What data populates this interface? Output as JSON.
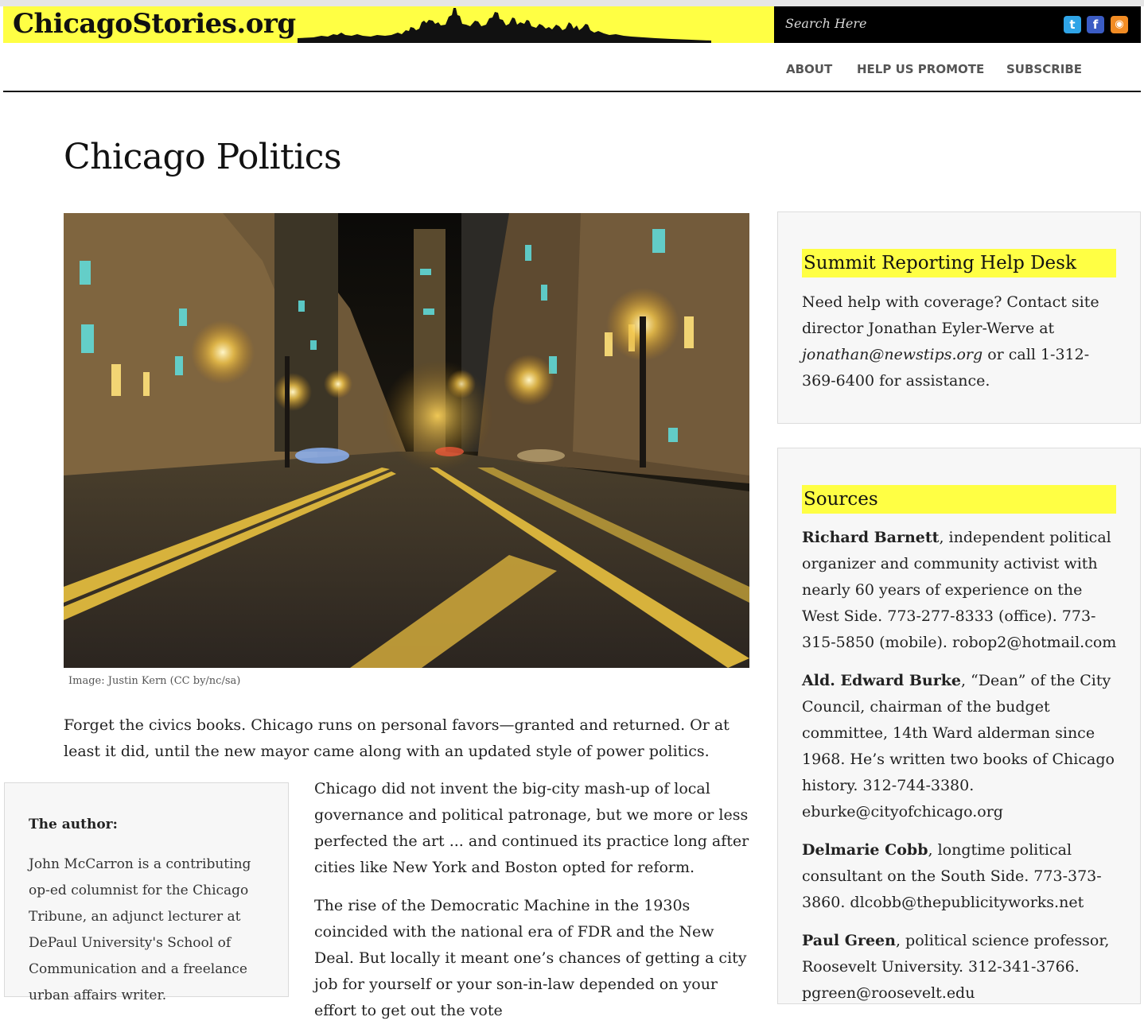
{
  "header": {
    "logo_text": "ChicagoStories.org",
    "search_placeholder": "Search Here",
    "social": [
      {
        "icon": "twitter-icon",
        "glyph": "t",
        "color": "#2fa4e7"
      },
      {
        "icon": "facebook-icon",
        "glyph": "f",
        "color": "#3b5cc4"
      },
      {
        "icon": "rss-icon",
        "glyph": "◉",
        "color": "#f28c24"
      }
    ],
    "nav": [
      "ABOUT",
      "HELP US PROMOTE",
      "SUBSCRIBE"
    ]
  },
  "article": {
    "title": "Chicago Politics",
    "image_caption": "Image: Justin Kern (CC by/nc/sa)",
    "lead": "Forget the civics books. Chicago runs on personal favors—granted and returned. Or at least it did, until the new mayor came along with an updated style of power politics.",
    "paragraphs": [
      "Chicago did not invent the big-city mash-up of local governance and political patronage, but we more or less perfected the art ... and continued its practice long after cities like New York and Boston opted for reform.",
      "The rise of the Democratic Machine in the 1930s coincided with the national era of FDR and the New Deal. But locally it meant one’s chances of getting a city job for yourself or your son-in-law depended on your effort to get out the vote"
    ]
  },
  "author_box": {
    "heading": "The author:",
    "text": "John McCarron is a contributing op-ed columnist for the Chicago Tribune, an adjunct lecturer at DePaul University's School of Communication and a freelance urban affairs writer."
  },
  "sidebar": {
    "help_desk": {
      "heading": "Summit Reporting Help Desk",
      "text_before": "Need help with coverage? Contact site director Jonathan Eyler-Werve at ",
      "email": "jonathan@newstips.org",
      "text_after": " or call 1-312-369-6400 for assistance."
    },
    "sources": {
      "heading": "Sources",
      "items": [
        {
          "name": "Richard Barnett",
          "detail": ", independent political organizer and community activist with nearly 60 years of experience on the West Side. 773-277-8333 (office). 773-315-5850 (mobile). robop2@hotmail.com"
        },
        {
          "name": "Ald. Edward Burke",
          "detail": ", “Dean” of the City Council, chairman of the budget committee, 14th Ward alderman since 1968. He’s written two books of Chicago history. 312-744-3380. eburke@cityofchicago.org"
        },
        {
          "name": "Delmarie Cobb",
          "detail": ", longtime political consultant on the South Side.  773-373-3860. dlcobb@thepublicityworks.net"
        },
        {
          "name": "Paul Green",
          "detail": ", political science professor, Roosevelt University. 312-341-3766. pgreen@roosevelt.edu"
        }
      ]
    }
  }
}
